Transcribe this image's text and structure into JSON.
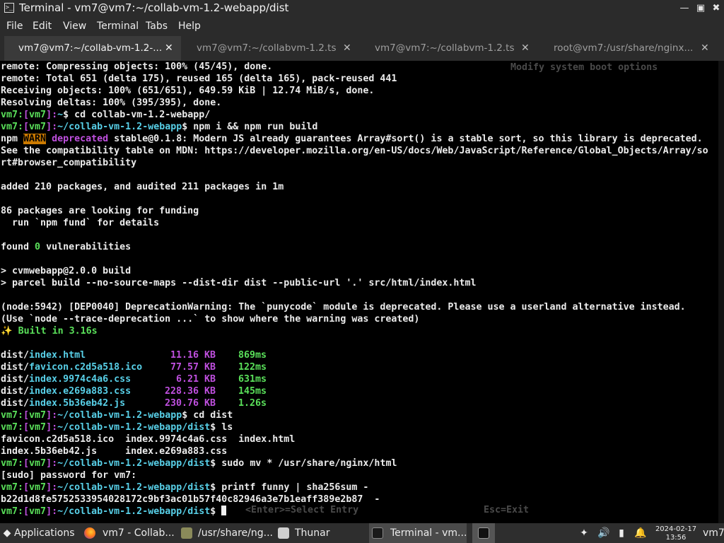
{
  "window": {
    "title": "Terminal - vm7@vm7:~/collab-vm-1.2-webapp/dist",
    "icon": "terminal-icon"
  },
  "menu": [
    "File",
    "Edit",
    "View",
    "Terminal",
    "Tabs",
    "Help"
  ],
  "tabs": [
    {
      "label": "vm7@vm7:~/collab-vm-1.2-...",
      "active": true
    },
    {
      "label": "vm7@vm7:~/collabvm-1.2.ts",
      "active": false
    },
    {
      "label": "vm7@vm7:~/collabvm-1.2.ts",
      "active": false
    },
    {
      "label": "root@vm7:/usr/share/nginx...",
      "active": false
    }
  ],
  "background_text": {
    "top": "Modify system boot options",
    "bottom_left": "<Enter>=Select Entry",
    "bottom_right": "Esc=Exit"
  },
  "prompt": {
    "user": "vm7:",
    "host": "vm7",
    "bracket_open": "[",
    "bracket_close": "]",
    "colon": ":",
    "dollar": "$"
  },
  "terminal": {
    "l0": "remote: Compressing objects: 100% (45/45), done.",
    "l1": "remote: Total 651 (delta 175), reused 165 (delta 165), pack-reused 441",
    "l2": "Receiving objects: 100% (651/651), 649.59 KiB | 12.74 MiB/s, done.",
    "l3": "Resolving deltas: 100% (395/395), done.",
    "p1_path": "~",
    "p1_cmd": " cd collab-vm-1.2-webapp/",
    "p2_path": "~/collab-vm-1.2-webapp",
    "p2_cmd": " npm i && npm run build",
    "npm_prefix": "npm ",
    "npm_warn": "WARN",
    "npm_deprecated": " deprecated",
    "npm_msg": " stable@0.1.8: Modern JS already guarantees Array#sort() is a stable sort, so this library is deprecated.",
    "l6": "See the compatibility table on MDN: https://developer.mozilla.org/en-US/docs/Web/JavaScript/Reference/Global_Objects/Array/so",
    "l7": "rt#browser_compatibility",
    "l9": "added 210 packages, and audited 211 packages in 1m",
    "l11": "86 packages are looking for funding",
    "l12": "  run `npm fund` for details",
    "l14_pre": "found ",
    "l14_num": "0",
    "l14_post": " vulnerabilities",
    "l16": "> cvmwebapp@2.0.0 build",
    "l17": "> parcel build --no-source-maps --dist-dir dist --public-url '.' src/html/index.html",
    "l19": "(node:5942) [DEP0040] DeprecationWarning: The `punycode` module is deprecated. Please use a userland alternative instead.",
    "l20": "(Use `node --trace-deprecation ...` to show where the warning was created)",
    "built_icon": "✨",
    "built": " Built in 3.16s",
    "p3_path": "~/collab-vm-1.2-webapp",
    "p3_cmd": " cd dist",
    "p4_path": "~/collab-vm-1.2-webapp/dist",
    "p4_cmd": " ls",
    "ls1": "favicon.c2d5a518.ico  index.9974c4a6.css  index.html",
    "ls2": "index.5b36eb42.js     index.e269a883.css",
    "p5_path": "~/collab-vm-1.2-webapp/dist",
    "p5_cmd": " sudo mv * /usr/share/nginx/html",
    "sudo": "[sudo] password for vm7:",
    "p6_path": "~/collab-vm-1.2-webapp/dist",
    "p6_cmd": " printf funny | sha256sum -",
    "hash": "b22d1d8fe5752533954028172c9bf3ac01b57f40c82946a3e7b1eaff389e2b87  -",
    "p7_path": "~/collab-vm-1.2-webapp/dist"
  },
  "build_files": [
    {
      "dir": "dist/",
      "name": "index.html",
      "size": "11.16 KB",
      "time": "869ms"
    },
    {
      "dir": "dist/",
      "name": "favicon.c2d5a518.ico",
      "size": "77.57 KB",
      "time": "122ms"
    },
    {
      "dir": "dist/",
      "name": "index.9974c4a6.css",
      "size": "6.21 KB",
      "time": "631ms"
    },
    {
      "dir": "dist/",
      "name": "index.e269a883.css",
      "size": "228.36 KB",
      "time": "145ms"
    },
    {
      "dir": "dist/",
      "name": "index.5b36eb42.js",
      "size": "230.76 KB",
      "time": "1.26s"
    }
  ],
  "taskbar": {
    "applications": "Applications",
    "apps": [
      {
        "label": "vm7 - Collab...",
        "icon": "firefox-icon"
      },
      {
        "label": "/usr/share/ng...",
        "icon": "text-editor-icon"
      },
      {
        "label": "Thunar",
        "icon": "file-manager-icon"
      },
      {
        "label": "Terminal - vm...",
        "icon": "terminal-icon"
      }
    ],
    "date": "2024-02-17",
    "time": "13:56",
    "user": "vm7"
  },
  "colors": {
    "prompt_green": "#5ae05a",
    "host_magenta": "#c050e0",
    "path_cyan": "#58d0e8",
    "warn_bg": "#cc7a00",
    "chrome_bg": "#2b2b2b"
  }
}
